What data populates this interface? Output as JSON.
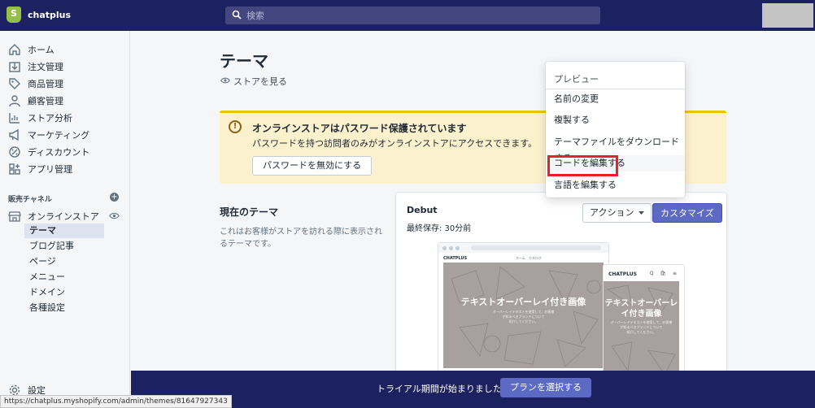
{
  "app": {
    "name": "chatplus"
  },
  "search": {
    "placeholder": "検索"
  },
  "sidebar": {
    "items": [
      {
        "label": "ホーム",
        "icon": "home-icon"
      },
      {
        "label": "注文管理",
        "icon": "orders-icon"
      },
      {
        "label": "商品管理",
        "icon": "tag-icon"
      },
      {
        "label": "顧客管理",
        "icon": "customer-icon"
      },
      {
        "label": "ストア分析",
        "icon": "analytics-icon"
      },
      {
        "label": "マーケティング",
        "icon": "megaphone-icon"
      },
      {
        "label": "ディスカウント",
        "icon": "discount-icon"
      },
      {
        "label": "アプリ管理",
        "icon": "apps-icon"
      }
    ],
    "channels_label": "販売チャネル",
    "online_store": "オンラインストア",
    "sub_items": [
      "テーマ",
      "ブログ記事",
      "ページ",
      "メニュー",
      "ドメイン",
      "各種設定"
    ],
    "settings": "設定"
  },
  "page": {
    "title": "テーマ",
    "view_store": "ストアを見る"
  },
  "banner": {
    "title": "オンラインストアはパスワード保護されています",
    "text": "パスワードを持つ訪問者のみがオンラインストアにアクセスできます。",
    "button": "パスワードを無効にする"
  },
  "current_theme": {
    "title": "現在のテーマ",
    "description": "これはお客様がストアを訪れる際に表示されるテーマです。",
    "name": "Debut",
    "last_saved": "最終保存: 30分前",
    "actions_button": "アクション",
    "customize_button": "カスタマイズ"
  },
  "preview": {
    "store_name": "CHATPLUS",
    "nav": "ホーム　カタログ",
    "hero_title_desktop": "テキストオーバーレイ付き画像",
    "hero_title_mobile_1": "テキストオーバーレ",
    "hero_title_mobile_2": "イ付き画像",
    "hero_text_1": "オーバーレイテキストを使用して、お客様",
    "hero_text_2": "が知るべきブランドについて",
    "hero_text_3": "紹介してください。",
    "mobile_icons": "Q 🛍 ≡"
  },
  "dropdown": {
    "header": "プレビュー",
    "items": [
      "名前の変更",
      "複製する",
      "テーマファイルをダウンロードする",
      "コードを編集する",
      "言語を編集する"
    ]
  },
  "bottom_bar": {
    "text": "トライアル期間が始まりました",
    "button": "プランを選択する"
  },
  "status_url": "https://chatplus.myshopify.com/admin/themes/81647927343",
  "colors": {
    "topbar": "#1c2260",
    "accent": "#5c6ac4",
    "banner_bg": "#fcf1cd",
    "highlight": "#e8202a"
  }
}
